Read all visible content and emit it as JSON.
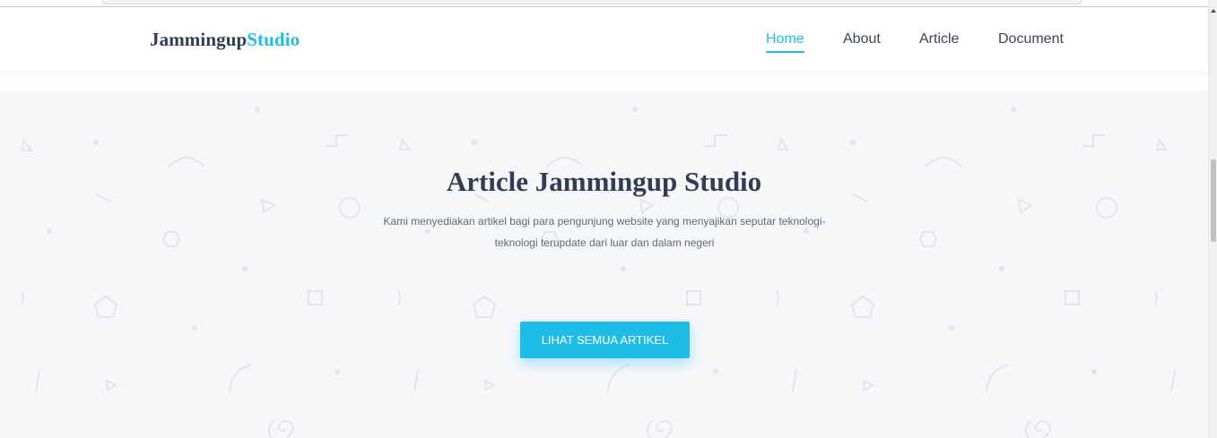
{
  "brand": {
    "name": "Jammingup",
    "accent": "Studio"
  },
  "nav": {
    "home": "Home",
    "about": "About",
    "article": "Article",
    "document": "Document"
  },
  "hero": {
    "title": "Article Jammingup Studio",
    "description": "Kami menyediakan artikel bagi para pengunjung website yang menyajikan seputar teknologi-teknologi terupdate dari luar dan dalam negeri",
    "button": "LIHAT SEMUA ARTIKEL"
  },
  "colors": {
    "accent": "#1ebde8",
    "heading": "#323c56",
    "hero_bg": "#f6f7f9"
  }
}
